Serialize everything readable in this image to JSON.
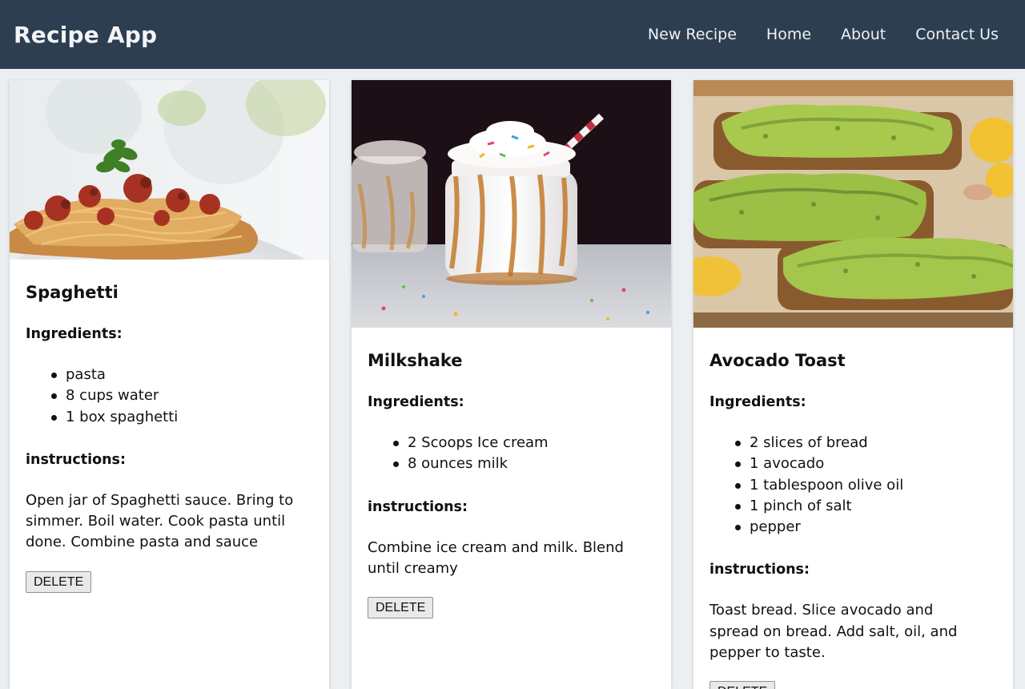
{
  "header": {
    "title": "Recipe App",
    "nav": [
      "New Recipe",
      "Home",
      "About",
      "Contact Us"
    ]
  },
  "colors": {
    "navbar_bg": "#2c3e50",
    "page_bg": "#eceff1",
    "card_bg": "#ffffff"
  },
  "recipes": [
    {
      "title": "Spaghetti",
      "image": "spaghetti-photo",
      "ingredients_label": "Ingredients:",
      "ingredients": [
        "pasta",
        "8 cups water",
        "1 box spaghetti"
      ],
      "instructions_label": "instructions:",
      "instructions": "Open jar of Spaghetti sauce. Bring to simmer. Boil water. Cook pasta until done. Combine pasta and sauce",
      "delete_label": "DELETE"
    },
    {
      "title": "Milkshake",
      "image": "milkshake-photo",
      "ingredients_label": "Ingredients:",
      "ingredients": [
        "2 Scoops Ice cream",
        "8 ounces milk"
      ],
      "instructions_label": "instructions:",
      "instructions": "Combine ice cream and milk. Blend until creamy",
      "delete_label": "DELETE"
    },
    {
      "title": "Avocado Toast",
      "image": "avocado-toast-photo",
      "ingredients_label": "Ingredients:",
      "ingredients": [
        "2 slices of bread",
        "1 avocado",
        "1 tablespoon olive oil",
        "1 pinch of salt",
        "pepper"
      ],
      "instructions_label": "instructions:",
      "instructions": "Toast bread. Slice avocado and spread on bread. Add salt, oil, and pepper to taste.",
      "delete_label": "DELETE"
    }
  ]
}
